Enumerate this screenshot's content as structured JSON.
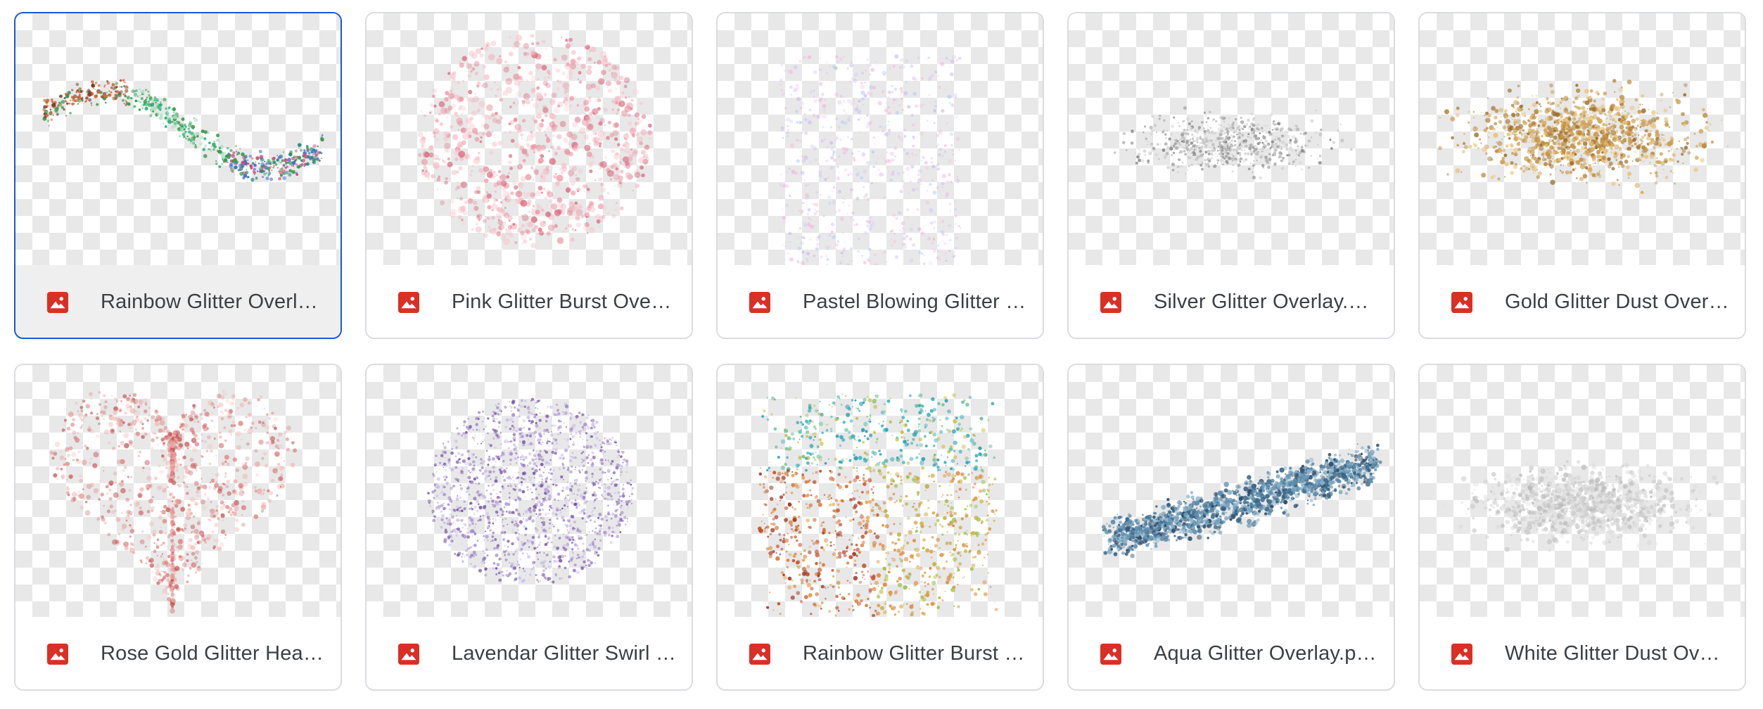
{
  "files": [
    {
      "name": "Rainbow Glitter Overlay.png",
      "selected": true,
      "icon": "image-file-icon"
    },
    {
      "name": "Pink Glitter Burst Overlay.png",
      "selected": false,
      "icon": "image-file-icon"
    },
    {
      "name": "Pastel Blowing Glitter Overlay.png",
      "selected": false,
      "icon": "image-file-icon"
    },
    {
      "name": "Silver Glitter Overlay.png",
      "selected": false,
      "icon": "image-file-icon"
    },
    {
      "name": "Gold Glitter Dust Overlay.png",
      "selected": false,
      "icon": "image-file-icon"
    },
    {
      "name": "Rose Gold Glitter Heart Overlay.png",
      "selected": false,
      "icon": "image-file-icon"
    },
    {
      "name": "Lavendar Glitter Swirl Overlay.png",
      "selected": false,
      "icon": "image-file-icon"
    },
    {
      "name": "Rainbow Glitter Burst Overlay.png",
      "selected": false,
      "icon": "image-file-icon"
    },
    {
      "name": "Aqua Glitter Overlay.png",
      "selected": false,
      "icon": "image-file-icon"
    },
    {
      "name": "White Glitter Dust Overlay.png",
      "selected": false,
      "icon": "image-file-icon"
    }
  ],
  "colors": {
    "icon_red": "#d93025",
    "selected_border": "#1a57d6",
    "card_border": "#dadce0",
    "text": "#3c4043"
  }
}
